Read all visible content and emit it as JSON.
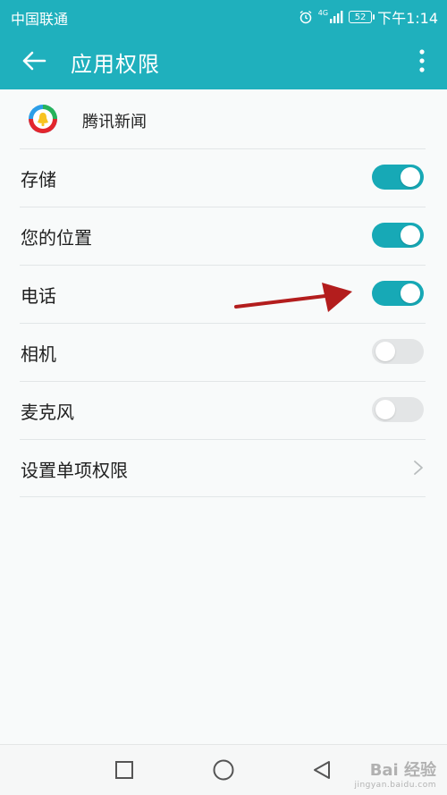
{
  "status_bar": {
    "carrier": "中国联通",
    "network": "4G",
    "battery": "52",
    "time": "下午1:14",
    "icons": [
      "alarm-icon",
      "signal-icon",
      "battery-icon"
    ]
  },
  "app_bar": {
    "title": "应用权限",
    "back_icon": "arrow-left-icon",
    "menu_icon": "more-vert-icon",
    "background": "#1fb0bd"
  },
  "app": {
    "name": "腾讯新闻",
    "icon": "tencent-news-logo"
  },
  "permissions": [
    {
      "label": "存储",
      "enabled": true
    },
    {
      "label": "您的位置",
      "enabled": true
    },
    {
      "label": "电话",
      "enabled": true
    },
    {
      "label": "相机",
      "enabled": false
    },
    {
      "label": "麦克风",
      "enabled": false
    }
  ],
  "single_permission": {
    "label": "设置单项权限",
    "icon": "chevron-right-icon"
  },
  "colors": {
    "accent": "#17a9b6",
    "toggle_off": "#e3e5e6",
    "annotation": "#b31d1d"
  },
  "nav_bar": {
    "icons": [
      "recent-apps-icon",
      "home-icon",
      "back-triangle-icon"
    ]
  },
  "watermark": {
    "text": "Bai 经验",
    "sub": "jingyan.baidu.com"
  }
}
